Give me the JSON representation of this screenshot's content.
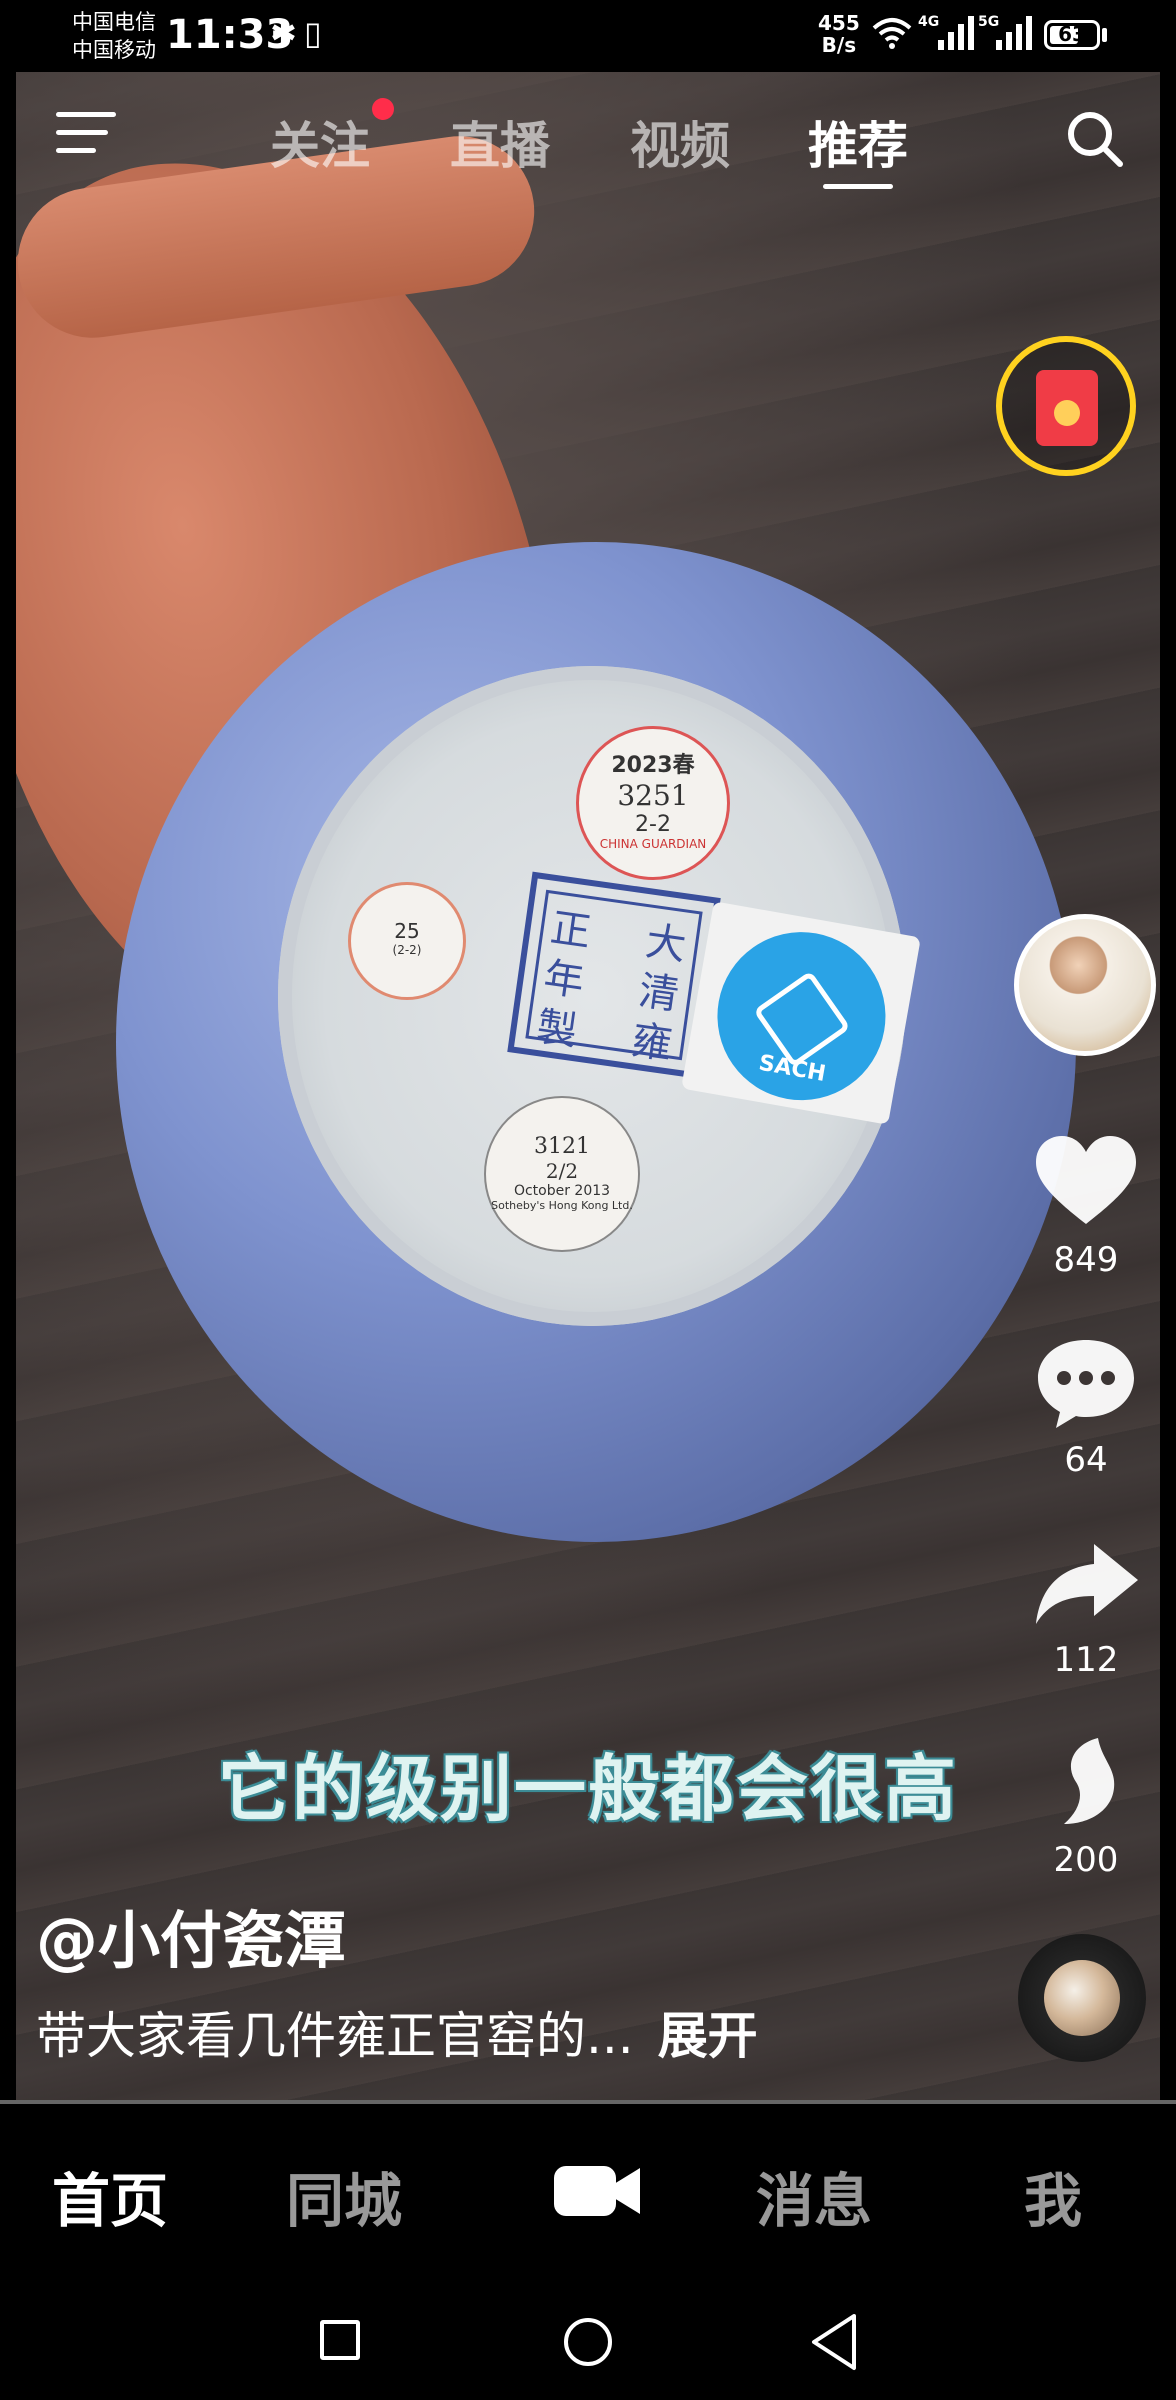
{
  "status_bar": {
    "carrier_1": "中国电信",
    "carrier_2": "中国移动",
    "time": "11:33",
    "net_speed_value": "455",
    "net_speed_unit": "B/s",
    "wifi_tag": "4G",
    "cell1_tag": "4G",
    "cell2_tag": "5G",
    "battery": "63",
    "battery_level": 0.63
  },
  "top_nav": {
    "tabs": [
      {
        "label": "关注",
        "has_dot": true
      },
      {
        "label": "直播"
      },
      {
        "label": "视频"
      },
      {
        "label": "推荐",
        "active": true
      }
    ],
    "search_icon": "search-icon",
    "menu_icon": "menu-icon"
  },
  "video": {
    "stickers": {
      "china_guardian": {
        "year": "2023春",
        "lot": "3251",
        "sub": "2-2",
        "house": "CHINA GUARDIAN"
      },
      "museum": {
        "lot": "25",
        "sub": "(2-2)"
      },
      "sothebys": {
        "lot": "3121",
        "sub": "2/2",
        "date": "October 2013",
        "house": "Sotheby's Hong Kong Ltd."
      },
      "seal_chars": [
        "大",
        "清",
        "雍",
        "正",
        "年",
        "製"
      ],
      "sach": "SACH"
    },
    "subtitle": "它的级别一般都会很高"
  },
  "rail": {
    "likes": "849",
    "comments": "64",
    "shares": "112",
    "favorites": "200"
  },
  "caption": {
    "author": "@小付瓷潭",
    "description": "带大家看几件雍正官窑的...",
    "expand": "展开"
  },
  "bottom_nav": {
    "items": [
      "首页",
      "同城",
      "消息",
      "我"
    ],
    "camera_icon": "camera-icon"
  },
  "colors": {
    "accent_red": "#ff2d4a",
    "redpacket_ring": "#ffd21f",
    "subtitle_outline": "#3c8c96"
  }
}
